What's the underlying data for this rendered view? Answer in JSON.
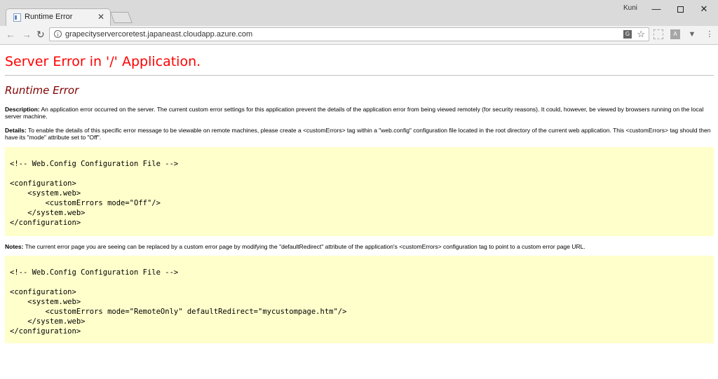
{
  "browser": {
    "tab_title": "Runtime Error",
    "tab_close": "✕",
    "user_name": "Kuni",
    "url": "grapecityservercoretest.japaneast.cloudapp.azure.com"
  },
  "page": {
    "title": "Server Error in '/' Application.",
    "subtitle": "Runtime Error",
    "description_label": "Description:",
    "description_text": "An application error occurred on the server. The current custom error settings for this application prevent the details of the application error from being viewed remotely (for security reasons). It could, however, be viewed by browsers running on the local server machine.",
    "details_label": "Details:",
    "details_text": "To enable the details of this specific error message to be viewable on remote machines, please create a <customErrors> tag within a \"web.config\" configuration file located in the root directory of the current web application. This <customErrors> tag should then have its \"mode\" attribute set to \"Off\".",
    "code1": "<!-- Web.Config Configuration File -->\n\n<configuration>\n    <system.web>\n        <customErrors mode=\"Off\"/>\n    </system.web>\n</configuration>",
    "notes_label": "Notes:",
    "notes_text": "The current error page you are seeing can be replaced by a custom error page by modifying the \"defaultRedirect\" attribute of the application's <customErrors> configuration tag to point to a custom error page URL.",
    "code2": "<!-- Web.Config Configuration File -->\n\n<configuration>\n    <system.web>\n        <customErrors mode=\"RemoteOnly\" defaultRedirect=\"mycustompage.htm\"/>\n    </system.web>\n</configuration>"
  },
  "colors": {
    "title": "#ff0000",
    "subtitle": "#800000",
    "code_background": "#ffffcc"
  }
}
